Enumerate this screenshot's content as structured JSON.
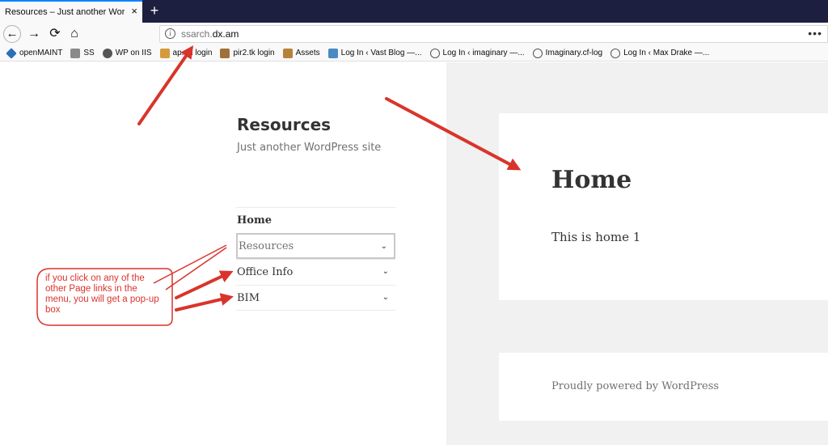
{
  "browser": {
    "tab": {
      "title": "Resources – Just another WordPress",
      "close": "×"
    },
    "new_tab": "+",
    "nav": {
      "back": "←",
      "forward": "→",
      "reload": "⟳",
      "home": "⌂"
    },
    "url": {
      "prefix": "ssarch.",
      "domain": "dx.am",
      "info": "i",
      "menu": "•••"
    },
    "bookmarks": [
      {
        "label": "openMAINT",
        "icon": "openmaint-icon",
        "color": "#2b6fb8"
      },
      {
        "label": "SS",
        "icon": "folder-icon",
        "color": "#8a8a8a"
      },
      {
        "label": "WP on IIS",
        "icon": "wordpress-icon",
        "color": "#555555"
      },
      {
        "label": "ap...n login",
        "icon": "image-icon",
        "color": "#d59a3c"
      },
      {
        "label": "pir2.tk login",
        "icon": "image-icon",
        "color": "#a0703a"
      },
      {
        "label": "Assets",
        "icon": "image-icon",
        "color": "#b5823a"
      },
      {
        "label": "Log In ‹ Vast Blog —...",
        "icon": "landscape-icon",
        "color": "#4a8bc4"
      },
      {
        "label": "Log In ‹ imaginary —...",
        "icon": "globe-icon",
        "color": "#555555"
      },
      {
        "label": "Imaginary.cf-log",
        "icon": "globe-icon",
        "color": "#555555"
      },
      {
        "label": "Log In ‹ Max Drake —...",
        "icon": "globe-icon",
        "color": "#555555"
      }
    ]
  },
  "site": {
    "title": "Resources",
    "description": "Just another WordPress site",
    "menu": [
      {
        "label": "Home"
      },
      {
        "label": "Resources",
        "chevron": "⌄"
      },
      {
        "label": "Office Info",
        "chevron": "⌄"
      },
      {
        "label": "BIM",
        "chevron": "⌄"
      }
    ],
    "page_heading": "Home",
    "page_body": "This is home 1",
    "footer": "Proudly powered by WordPress"
  },
  "annotation": {
    "callout": "if you click on any of the other Page links in the menu, you will get a pop-up box",
    "color": "#d9342b"
  }
}
